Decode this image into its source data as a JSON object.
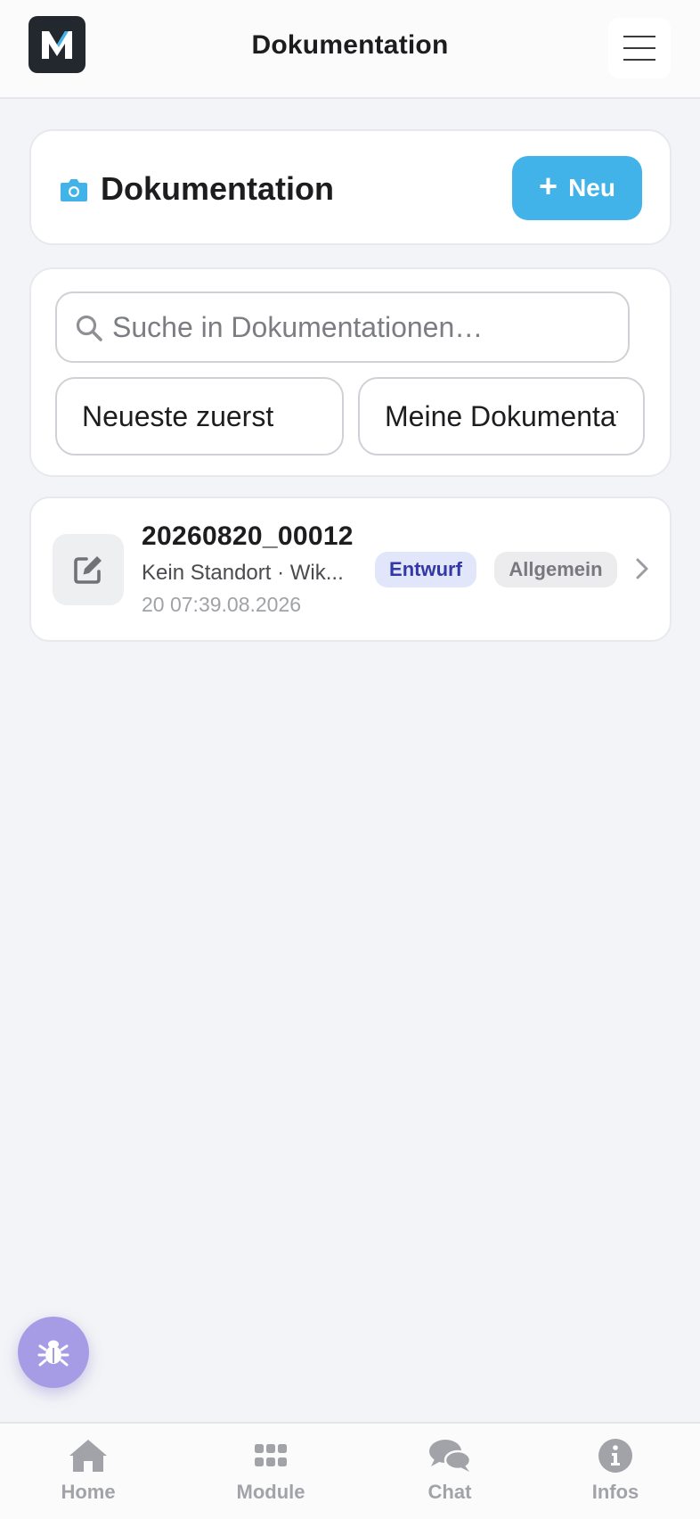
{
  "topbar": {
    "logo_letter": "M",
    "title": "Dokumentation",
    "menu_icon": "hamburger-menu-icon"
  },
  "header": {
    "icon": "camera-icon",
    "title": "Dokumentation",
    "new_button_icon": "plus-icon",
    "new_button_label": "Neu",
    "accent_color": "#42b3e8"
  },
  "filters": {
    "search_icon": "search-icon",
    "search_placeholder": "Suche in Dokumentationen…",
    "search_value": "",
    "sort_selected": "Neueste zuerst",
    "scope_selected": "Meine Dokumentationen"
  },
  "documents": [
    {
      "icon": "edit-icon",
      "title": "20260820_00012",
      "subtitle": "Kein Standort · Wik...",
      "date": "20 07:39.08.2026",
      "status": "Entwurf",
      "category": "Allgemein",
      "chevron_icon": "chevron-right-icon"
    }
  ],
  "floating": {
    "bug_icon": "bug-icon",
    "color": "#a69ce6"
  },
  "bottom_nav": {
    "items": [
      {
        "label": "Home",
        "icon": "home-icon"
      },
      {
        "label": "Module",
        "icon": "grid-icon"
      },
      {
        "label": "Chat",
        "icon": "chat-icon"
      },
      {
        "label": "Infos",
        "icon": "info-icon"
      }
    ]
  }
}
